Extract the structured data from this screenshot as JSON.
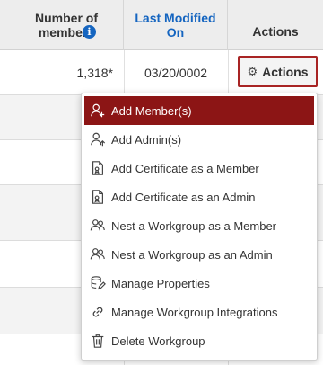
{
  "table": {
    "headers": {
      "members": "Number of members",
      "members_line1": "Number of",
      "members_line2": "members",
      "last_modified_line1": "Last Modified",
      "last_modified_line2": "On",
      "actions": "Actions"
    },
    "row": {
      "members": "1,318*",
      "date": "03/20/0002"
    }
  },
  "actions_button": {
    "label": "Actions",
    "icon": "gear-icon"
  },
  "menu": {
    "items": [
      {
        "label": "Add Member(s)",
        "icon": "add-user-icon",
        "active": true
      },
      {
        "label": "Add Admin(s)",
        "icon": "add-admin-icon"
      },
      {
        "label": "Add Certificate as a Member",
        "icon": "certificate-icon"
      },
      {
        "label": "Add Certificate as an Admin",
        "icon": "certificate-admin-icon"
      },
      {
        "label": "Nest a Workgroup as a Member",
        "icon": "users-icon"
      },
      {
        "label": "Nest a Workgroup as an Admin",
        "icon": "users-admin-icon"
      },
      {
        "label": "Manage Properties",
        "icon": "database-edit-icon"
      },
      {
        "label": "Manage Workgroup Integrations",
        "icon": "link-icon"
      },
      {
        "label": "Delete Workgroup",
        "icon": "trash-icon"
      }
    ]
  },
  "colors": {
    "accent": "#8c1515",
    "link": "#1565c0",
    "header_bg": "#ededed"
  }
}
